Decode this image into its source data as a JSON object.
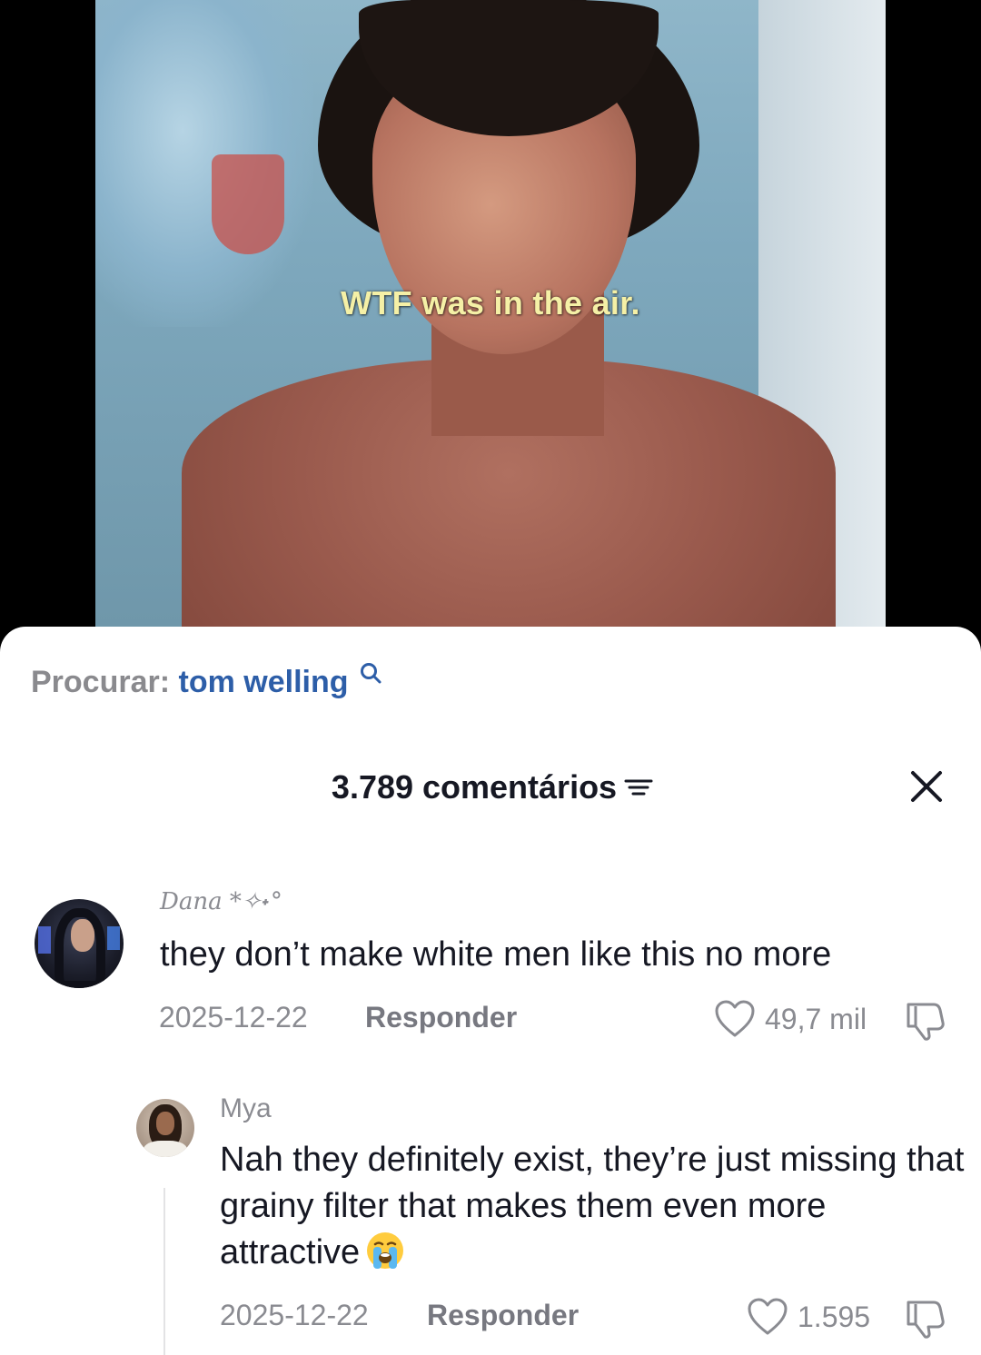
{
  "video": {
    "caption": "WTF was in the air."
  },
  "search": {
    "label": "Procurar:",
    "term": "tom welling"
  },
  "comments_header": {
    "count_label": "3.789 comentários"
  },
  "comments": [
    {
      "username": "Dana *✧˖°",
      "text": "they don’t make white men like this no more",
      "date": "2025-12-22",
      "reply_label": "Responder",
      "likes": "49,7 mil"
    },
    {
      "username": "Mya",
      "text": "Nah they definitely exist, they’re just missing that grainy filter that makes them even more attractive",
      "emoji": "loudly-crying-face",
      "date": "2025-12-22",
      "reply_label": "Responder",
      "likes": "1.595"
    }
  ],
  "colors": {
    "search_term": "#2d5ea8",
    "caption": "#f5f0a6",
    "text_primary": "#161823",
    "text_secondary": "#8a8b91"
  }
}
